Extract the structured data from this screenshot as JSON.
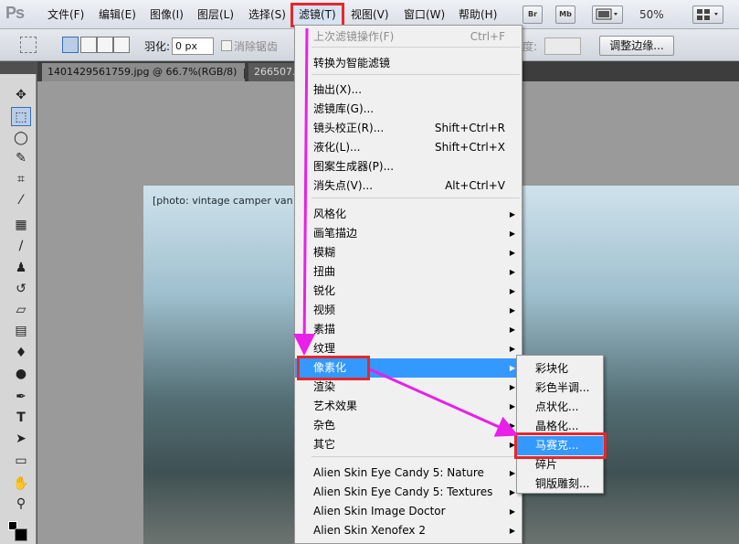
{
  "app": {
    "logo": "Ps"
  },
  "menubar": {
    "file": "文件(F)",
    "edit": "编辑(E)",
    "image": "图像(I)",
    "layer": "图层(L)",
    "select": "选择(S)",
    "filter": "滤镜(T)",
    "view": "视图(V)",
    "window": "窗口(W)",
    "help": "帮助(H)",
    "br": "Br",
    "mb": "Mb",
    "zoom": "50%"
  },
  "options": {
    "feather_label": "羽化:",
    "feather_value": "0 px",
    "antialias": "消除锯齿",
    "refine_button": "调整边缘...",
    "partial_label": "度:"
  },
  "tabs": [
    {
      "label": "1401429561759.jpg @ 66.7%(RGB/8)",
      "close": "×"
    },
    {
      "label": "266507.jp"
    }
  ],
  "filter_menu": {
    "items": [
      {
        "label": "上次滤镜操作(F)",
        "shortcut": "Ctrl+F",
        "disabled": true
      },
      {
        "label": "转换为智能滤镜"
      },
      {
        "label": "抽出(X)..."
      },
      {
        "label": "滤镜库(G)..."
      },
      {
        "label": "镜头校正(R)...",
        "shortcut": "Shift+Ctrl+R"
      },
      {
        "label": "液化(L)...",
        "shortcut": "Shift+Ctrl+X"
      },
      {
        "label": "图案生成器(P)..."
      },
      {
        "label": "消失点(V)...",
        "shortcut": "Alt+Ctrl+V"
      },
      {
        "label": "风格化"
      },
      {
        "label": "画笔描边"
      },
      {
        "label": "模糊"
      },
      {
        "label": "扭曲"
      },
      {
        "label": "锐化"
      },
      {
        "label": "视频"
      },
      {
        "label": "素描"
      },
      {
        "label": "纹理"
      },
      {
        "label": "像素化"
      },
      {
        "label": "渲染"
      },
      {
        "label": "艺术效果"
      },
      {
        "label": "杂色"
      },
      {
        "label": "其它"
      },
      {
        "label": "Alien Skin Eye Candy 5: Nature"
      },
      {
        "label": "Alien Skin Eye Candy 5: Textures"
      },
      {
        "label": "Alien Skin Image Doctor"
      },
      {
        "label": "Alien Skin Xenofex 2"
      }
    ]
  },
  "pixelate_menu": {
    "items": [
      {
        "label": "彩块化"
      },
      {
        "label": "彩色半调..."
      },
      {
        "label": "点状化..."
      },
      {
        "label": "晶格化..."
      },
      {
        "label": "马赛克..."
      },
      {
        "label": "碎片"
      },
      {
        "label": "铜版雕刻..."
      }
    ]
  },
  "photo": {
    "label": "[photo: vintage camper van with palm trees]"
  },
  "colors": {
    "highlight": "#3399ff",
    "annotation": "#e8262a",
    "arrow": "#e820e8"
  }
}
